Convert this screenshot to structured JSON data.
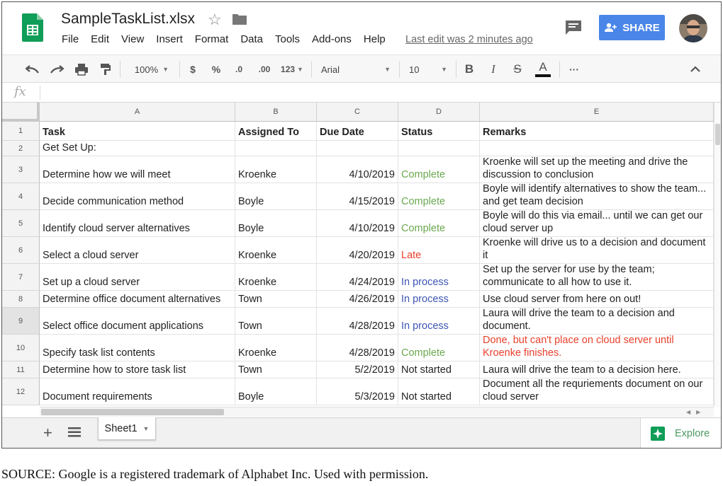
{
  "header": {
    "doc_title": "SampleTaskList.xlsx",
    "menu": [
      "File",
      "Edit",
      "View",
      "Insert",
      "Format",
      "Data",
      "Tools",
      "Add-ons",
      "Help"
    ],
    "last_edit": "Last edit was 2 minutes ago",
    "share_label": "SHARE",
    "share_color": "#4a86e8"
  },
  "toolbar": {
    "zoom": "100%",
    "currency": "$",
    "percent": "%",
    "decrease_decimals": ".0",
    "increase_decimals": ".00",
    "more_formats": "123",
    "font": "Arial",
    "font_size": "10",
    "bold": "B",
    "italic": "I",
    "strikethrough": "S",
    "text_color": "A",
    "more": "···"
  },
  "formula_bar": {
    "fx": "fx"
  },
  "grid": {
    "columns": [
      "A",
      "B",
      "C",
      "D",
      "E"
    ],
    "row_numbers": [
      "1",
      "2",
      "3",
      "4",
      "5",
      "6",
      "7",
      "8",
      "9",
      "10",
      "11",
      "12"
    ],
    "header_row": {
      "task": "Task",
      "assigned": "Assigned To",
      "due": "Due Date",
      "status": "Status",
      "remarks": "Remarks"
    },
    "section_label": "Get Set Up:",
    "rows": [
      {
        "task": "Determine how we will meet",
        "assigned": "Kroenke",
        "due": "4/10/2019",
        "status": "Complete",
        "status_kind": "complete",
        "remarks": "Kroenke will set up the meeting and drive the discussion to conclusion",
        "remarks_kind": "normal"
      },
      {
        "task": "Decide communication method",
        "assigned": "Boyle",
        "due": "4/15/2019",
        "status": "Complete",
        "status_kind": "complete",
        "remarks": "Boyle will identify alternatives to show the team... and get team decision",
        "remarks_kind": "normal"
      },
      {
        "task": "Identify cloud server alternatives",
        "assigned": "Boyle",
        "due": "4/10/2019",
        "status": "Complete",
        "status_kind": "complete",
        "remarks": "Boyle will do this via email... until we can get our cloud server up",
        "remarks_kind": "normal"
      },
      {
        "task": "Select a cloud server",
        "assigned": "Kroenke",
        "due": "4/20/2019",
        "status": "Late",
        "status_kind": "late",
        "remarks": "Kroenke will drive us to a decision and document it",
        "remarks_kind": "normal"
      },
      {
        "task": "Set up a cloud server",
        "assigned": "Kroenke",
        "due": "4/24/2019",
        "status": "In process",
        "status_kind": "process",
        "remarks": "Set up the server for use by the team; communicate to all how to use it.",
        "remarks_kind": "normal"
      },
      {
        "task": "Determine office document alternatives",
        "assigned": "Town",
        "due": "4/26/2019",
        "status": "In process",
        "status_kind": "process",
        "remarks": "Use cloud server from here on out!",
        "remarks_kind": "normal"
      },
      {
        "task": "Select office document applications",
        "assigned": "Town",
        "due": "4/28/2019",
        "status": "In process",
        "status_kind": "process",
        "remarks": "Laura will drive the team to a decision and document.",
        "remarks_kind": "normal"
      },
      {
        "task": "Specify task list contents",
        "assigned": "Kroenke",
        "due": "4/28/2019",
        "status": "Complete",
        "status_kind": "complete",
        "remarks": "Done, but can't place on cloud server until Kroenke finishes.",
        "remarks_kind": "red"
      },
      {
        "task": "Determine how to store task list",
        "assigned": "Town",
        "due": "5/2/2019",
        "status": "Not started",
        "status_kind": "not",
        "remarks": "Laura will drive the team to a decision here.",
        "remarks_kind": "normal"
      },
      {
        "task": "Document requirements",
        "assigned": "Boyle",
        "due": "5/3/2019",
        "status": "Not started",
        "status_kind": "not",
        "remarks": "Document all the requriements document on our cloud server",
        "remarks_kind": "normal"
      }
    ],
    "status_colors": {
      "complete": "#6aa84f",
      "late": "#e8402c",
      "process": "#3d55b4",
      "not": "#222222"
    }
  },
  "bottom": {
    "add_sheet": "+",
    "sheet_tab": "Sheet1",
    "explore": "Explore"
  },
  "source_note": "SOURCE: Google is a registered trademark of Alphabet Inc. Used with permission."
}
